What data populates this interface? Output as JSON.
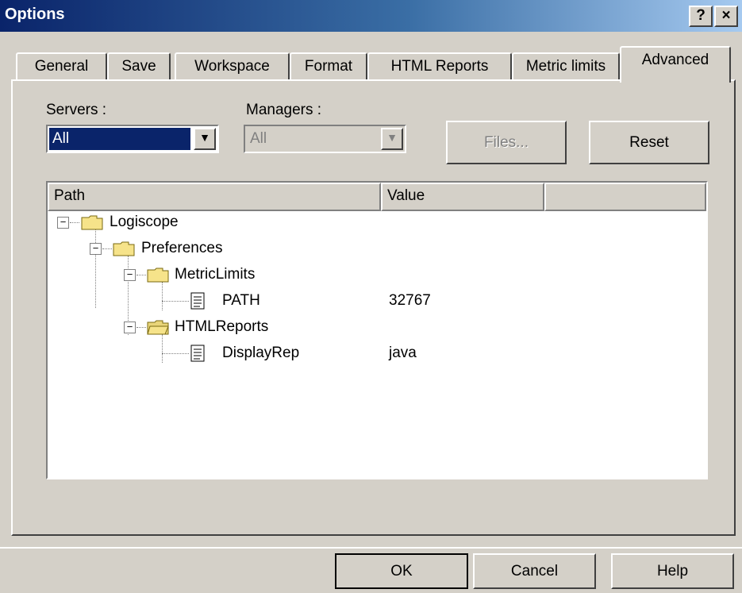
{
  "window": {
    "title": "Options",
    "help_button": "?",
    "close_button": "×"
  },
  "tabs": [
    {
      "label": "General"
    },
    {
      "label": "Save"
    },
    {
      "label": "Workspace"
    },
    {
      "label": "Format"
    },
    {
      "label": "HTML Reports"
    },
    {
      "label": "Metric limits"
    },
    {
      "label": "Advanced",
      "active": true
    }
  ],
  "advanced": {
    "servers": {
      "label": "Servers :",
      "value": "All"
    },
    "managers": {
      "label": "Managers :",
      "value": "All",
      "disabled": true
    },
    "files_button": "Files...",
    "reset_button": "Reset",
    "tree": {
      "columns": [
        "Path",
        "Value",
        ""
      ],
      "nodes": [
        {
          "name": "Logiscope",
          "value": ""
        },
        {
          "name": "Preferences",
          "value": ""
        },
        {
          "name": "MetricLimits",
          "value": ""
        },
        {
          "name": "PATH",
          "value": "32767"
        },
        {
          "name": "HTMLReports",
          "value": ""
        },
        {
          "name": "DisplayRep",
          "value": "java"
        }
      ]
    }
  },
  "footer": {
    "ok": "OK",
    "cancel": "Cancel",
    "help": "Help"
  },
  "colors": {
    "title_bar_start": "#0a246a",
    "title_bar_end": "#a6caf0",
    "selection": "#0a246a",
    "face": "#d4d0c8"
  }
}
